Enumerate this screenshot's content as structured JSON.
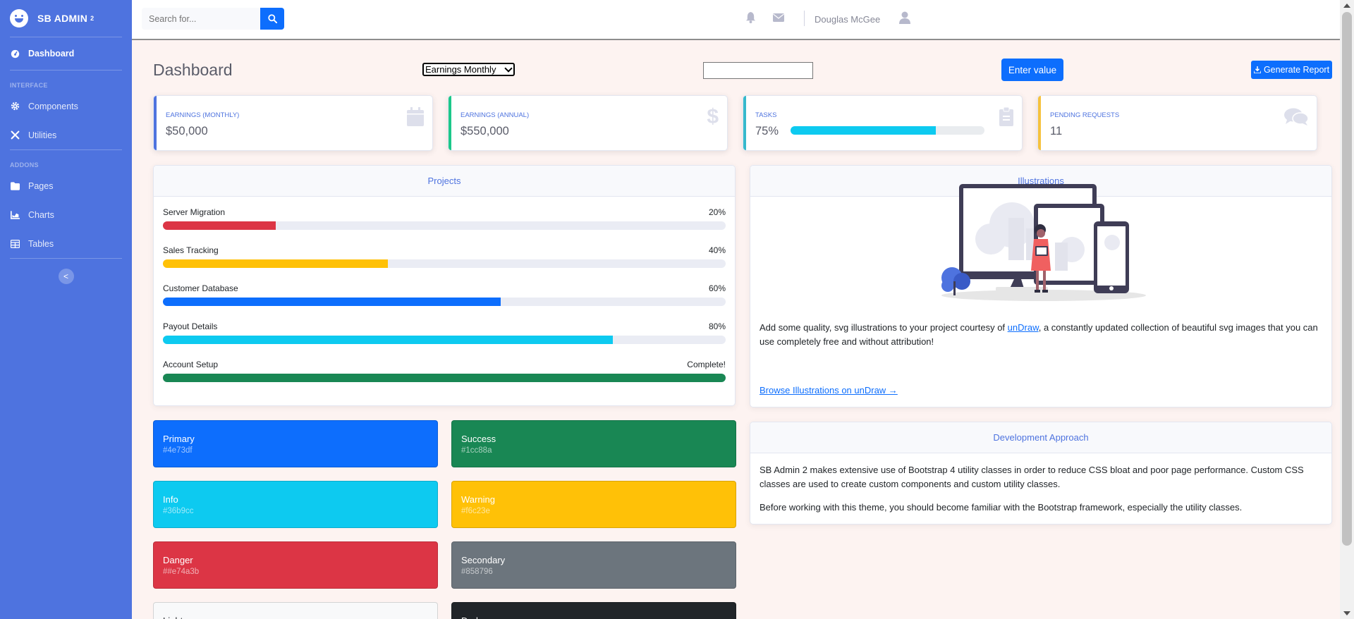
{
  "sidebar": {
    "brand": "SB ADMIN",
    "brand_sup": "2",
    "active_item": "Dashboard",
    "heading_interface": "INTERFACE",
    "heading_addons": "ADDONS",
    "items": [
      {
        "label": "Components",
        "icon": "gear-icon"
      },
      {
        "label": "Utilities",
        "icon": "wrench-icon"
      },
      {
        "label": "Pages",
        "icon": "folder-icon"
      },
      {
        "label": "Charts",
        "icon": "chart-icon"
      },
      {
        "label": "Tables",
        "icon": "table-icon"
      }
    ],
    "toggle": "<"
  },
  "topbar": {
    "search_placeholder": "Search for...",
    "username": "Douglas McGee"
  },
  "main": {
    "title": "Dashboard",
    "select_value": "Earnings Monthly",
    "enter_button": "Enter value",
    "report_button": "Generate Report"
  },
  "stats": [
    {
      "label": "EARNINGS (MONTHLY)",
      "value": "$50,000",
      "color": "#4e73df",
      "icon": "calendar-icon"
    },
    {
      "label": "EARNINGS (ANNUAL)",
      "value": "$550,000",
      "color": "#1cc88a",
      "icon": "dollar-icon"
    },
    {
      "label": "TASKS",
      "value": "75%",
      "progress": 75,
      "color": "#36b9cc",
      "icon": "clipboard-icon"
    },
    {
      "label": "PENDING REQUESTS",
      "value": "11",
      "color": "#f6c23e",
      "icon": "comments-icon"
    }
  ],
  "projects": {
    "title": "Projects",
    "items": [
      {
        "name": "Server Migration",
        "status": "20%",
        "progress": 20,
        "color": "#dc3545"
      },
      {
        "name": "Sales Tracking",
        "status": "40%",
        "progress": 40,
        "color": "#ffc107"
      },
      {
        "name": "Customer Database",
        "status": "60%",
        "progress": 60,
        "color": "#0d6efd"
      },
      {
        "name": "Payout Details",
        "status": "80%",
        "progress": 80,
        "color": "#0dcaf0"
      },
      {
        "name": "Account Setup",
        "status": "Complete!",
        "progress": 100,
        "color": "#198754"
      }
    ]
  },
  "illustrations": {
    "title": "Illustrations",
    "text_before": "Add some quality, svg illustrations to your project courtesy of ",
    "link_undraw": "unDraw",
    "text_after": ", a constantly updated collection of beautiful svg images that you can use completely free and without attribution!",
    "browse_link": "Browse Illustrations on unDraw →"
  },
  "development": {
    "title": "Development Approach",
    "p1": "SB Admin 2 makes extensive use of Bootstrap 4 utility classes in order to reduce CSS bloat and poor page performance. Custom CSS classes are used to create custom components and custom utility classes.",
    "p2": "Before working with this theme, you should become familiar with the Bootstrap framework, especially the utility classes."
  },
  "color_cards": [
    {
      "name": "Primary",
      "hex": "#4e73df",
      "bg": "#0d6efd",
      "fg": "#ffffff"
    },
    {
      "name": "Success",
      "hex": "#1cc88a",
      "bg": "#198754",
      "fg": "#ffffff"
    },
    {
      "name": "Info",
      "hex": "#36b9cc",
      "bg": "#0dcaf0",
      "fg": "#ffffff"
    },
    {
      "name": "Warning",
      "hex": "#f6c23e",
      "bg": "#ffc107",
      "fg": "#ffffff"
    },
    {
      "name": "Danger",
      "hex": "##e74a3b",
      "bg": "#dc3545",
      "fg": "#ffffff"
    },
    {
      "name": "Secondary",
      "hex": "#858796",
      "bg": "#6c757d",
      "fg": "#ffffff"
    },
    {
      "name": "Light",
      "hex": "",
      "bg": "#f8f9fa",
      "fg": "#212529"
    },
    {
      "name": "Dark",
      "hex": "",
      "bg": "#212529",
      "fg": "#ffffff"
    }
  ]
}
